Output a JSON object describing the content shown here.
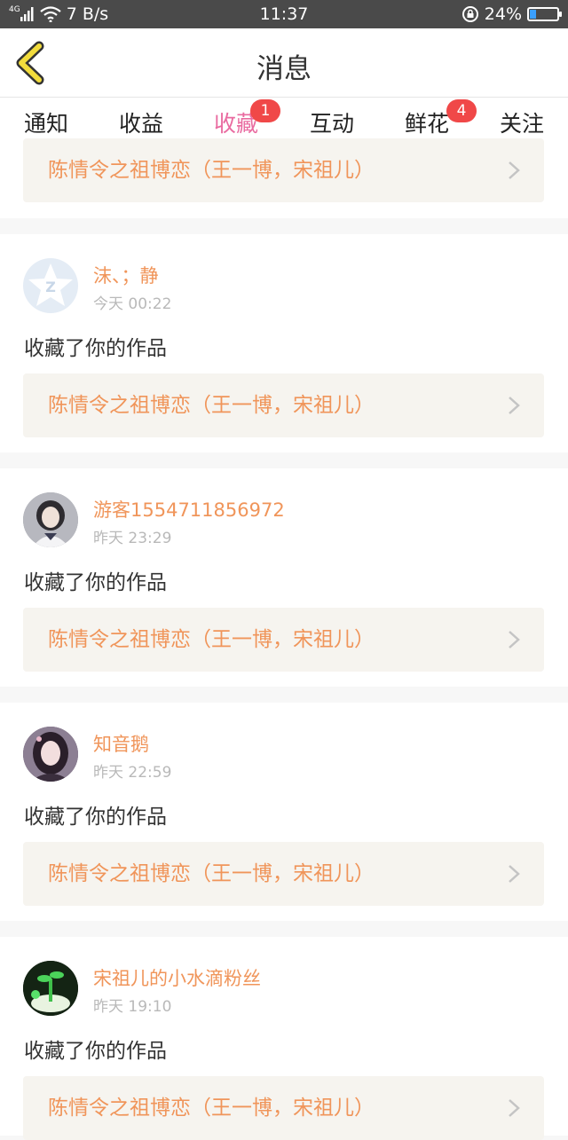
{
  "status_bar": {
    "network": "4G",
    "speed": "7 B/s",
    "time": "11:37",
    "battery": "24%",
    "battery_level": 0.24
  },
  "header": {
    "title": "消息"
  },
  "tabs": [
    {
      "label": "通知",
      "badge": null,
      "active": false
    },
    {
      "label": "收益",
      "badge": null,
      "active": false
    },
    {
      "label": "收藏",
      "badge": "1",
      "active": true
    },
    {
      "label": "互动",
      "badge": null,
      "active": false
    },
    {
      "label": "鲜花",
      "badge": "4",
      "active": false
    },
    {
      "label": "关注",
      "badge": null,
      "active": false
    }
  ],
  "feed": {
    "partial_top": {
      "work": "陈情令之祖博恋（王一博，宋祖儿）"
    },
    "items": [
      {
        "user": "沫、；静",
        "time": "今天 00:22",
        "action": "收藏了你的作品",
        "work": "陈情令之祖博恋（王一博，宋祖儿）"
      },
      {
        "user": "游客1554711856972",
        "time": "昨天 23:29",
        "action": "收藏了你的作品",
        "work": "陈情令之祖博恋（王一博，宋祖儿）"
      },
      {
        "user": "知音鹅",
        "time": "昨天 22:59",
        "action": "收藏了你的作品",
        "work": "陈情令之祖博恋（王一博，宋祖儿）"
      },
      {
        "user": "宋祖儿的小水滴粉丝",
        "time": "昨天 19:10",
        "action": "收藏了你的作品",
        "work": "陈情令之祖博恋（王一博，宋祖儿）"
      }
    ]
  },
  "colors": {
    "accent": "#e96ba0",
    "username": "#f0955a",
    "badge": "#f04848",
    "back_arrow": "#f2dc3c"
  }
}
